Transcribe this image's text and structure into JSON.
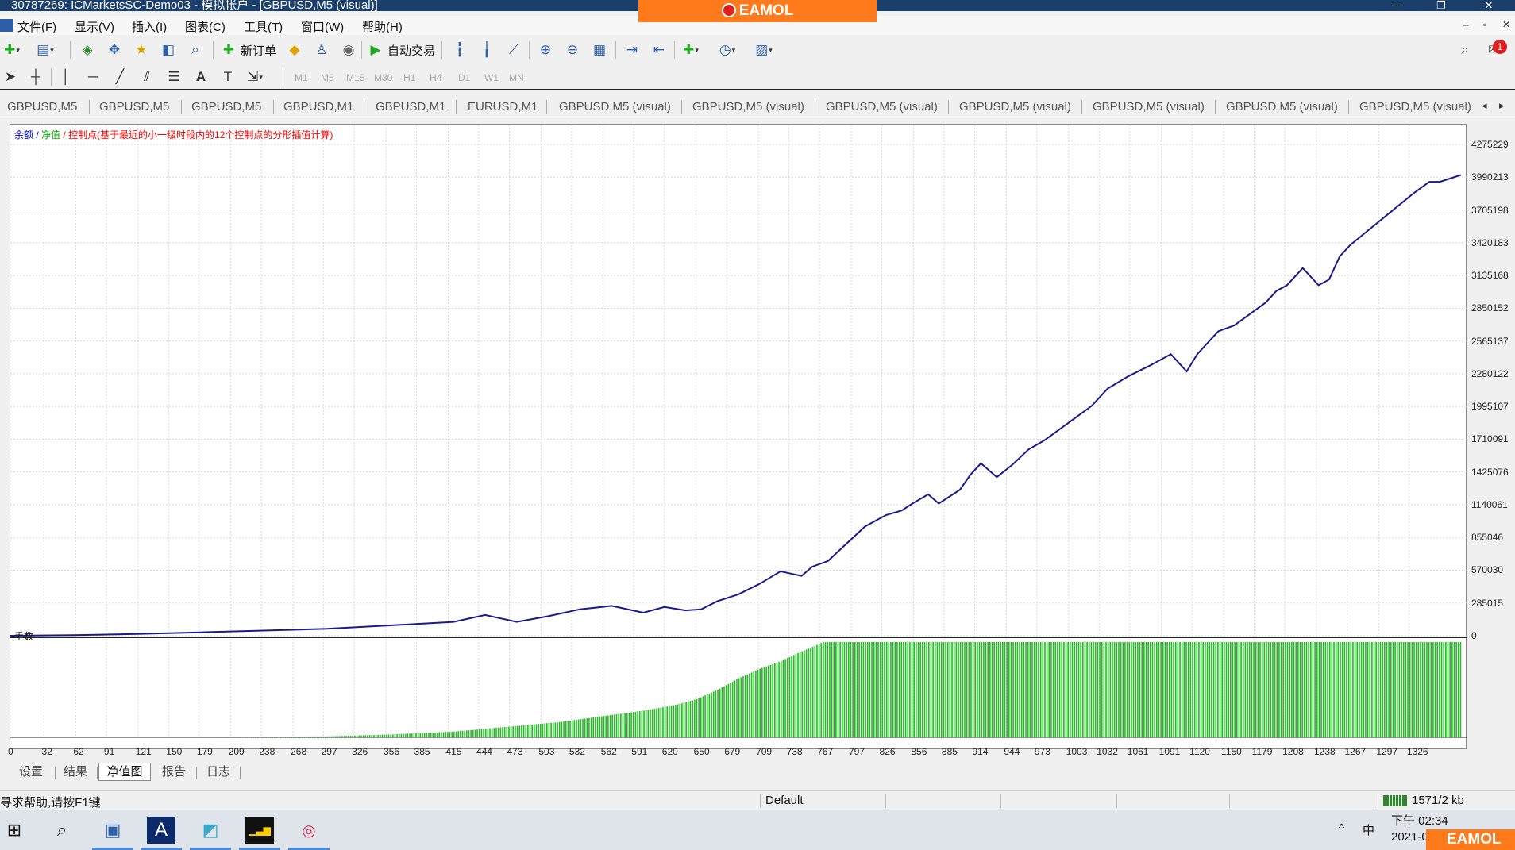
{
  "titlebar": {
    "title": "30787269: ICMarketsSC-Demo03 - 模拟帐户 - [GBPUSD,M5 (visual)]",
    "minimize": "–",
    "restore": "❐",
    "close": "✕"
  },
  "brand": {
    "text": "EAMOL"
  },
  "menu": {
    "items": [
      "文件(F)",
      "显示(V)",
      "插入(I)",
      "图表(C)",
      "工具(T)",
      "窗口(W)",
      "帮助(H)"
    ],
    "doc_controls": [
      "–",
      "▫",
      "✕"
    ]
  },
  "toolbar": {
    "new_order": "新订单",
    "auto_trading": "自动交易",
    "notification_count": "1"
  },
  "timeframes": [
    "M1",
    "M5",
    "M15",
    "M30",
    "H1",
    "H4",
    "D1",
    "W1",
    "MN"
  ],
  "chart_tabs": [
    "GBPUSD,M5",
    "GBPUSD,M5",
    "GBPUSD,M5",
    "GBPUSD,M1",
    "GBPUSD,M1",
    "EURUSD,M1",
    "GBPUSD,M5 (visual)",
    "GBPUSD,M5 (visual)",
    "GBPUSD,M5 (visual)",
    "GBPUSD,M5 (visual)",
    "GBPUSD,M5 (visual)",
    "GBPUSD,M5 (visual)",
    "GBPUSD,M5 (visual)"
  ],
  "legend": {
    "balance": "余额",
    "sep1": " / ",
    "equity": "净值",
    "sep2": " / ",
    "note": "控制点(基于最近的小一级时段内的12个控制点的分形插值计算)",
    "balance_color": "#0000cc",
    "equity_color": "#00a000",
    "note_color": "#ff0000"
  },
  "lot_label": "手数",
  "bottom_tabs": [
    "设置",
    "结果",
    "净值图",
    "报告",
    "日志"
  ],
  "status": {
    "help": "寻求帮助,请按F1键",
    "profile": "Default",
    "traffic": "1571/2 kb"
  },
  "tray": {
    "caret": "^",
    "ime": "中",
    "time": "下午 02:34",
    "date": "2021-0"
  },
  "chart_data": {
    "type": "line",
    "y_ticks": [
      "4275229",
      "3990213",
      "3705198",
      "3420183",
      "3135168",
      "2850152",
      "2565137",
      "2280122",
      "1995107",
      "1710091",
      "1425076",
      "1140061",
      "855046",
      "570030",
      "285015",
      "0"
    ],
    "x_ticks": [
      "0",
      "32",
      "62",
      "91",
      "121",
      "150",
      "179",
      "209",
      "238",
      "268",
      "297",
      "326",
      "356",
      "385",
      "415",
      "444",
      "473",
      "503",
      "532",
      "562",
      "591",
      "620",
      "650",
      "679",
      "709",
      "738",
      "767",
      "797",
      "826",
      "856",
      "885",
      "914",
      "944",
      "973",
      "1003",
      "1032",
      "1061",
      "1091",
      "1120",
      "1150",
      "1179",
      "1208",
      "1238",
      "1267",
      "1297",
      "1326"
    ],
    "ylim": [
      0,
      4275229
    ],
    "xlim": [
      0,
      1375
    ],
    "grid": true,
    "series": [
      {
        "name": "余额",
        "color": "#1a1a8c",
        "x": [
          0,
          60,
          120,
          180,
          240,
          300,
          360,
          420,
          450,
          480,
          510,
          540,
          570,
          600,
          620,
          640,
          655,
          670,
          690,
          710,
          730,
          750,
          760,
          775,
          790,
          810,
          830,
          845,
          855,
          870,
          880,
          900,
          910,
          920,
          935,
          950,
          965,
          980,
          995,
          1010,
          1025,
          1040,
          1060,
          1080,
          1100,
          1115,
          1125,
          1145,
          1160,
          1175,
          1190,
          1200,
          1210,
          1225,
          1240,
          1250,
          1260,
          1270,
          1290,
          1310,
          1330,
          1345,
          1355,
          1375
        ],
        "y": [
          0,
          5000,
          15000,
          30000,
          45000,
          60000,
          90000,
          120000,
          180000,
          120000,
          170000,
          230000,
          260000,
          200000,
          250000,
          220000,
          230000,
          300000,
          360000,
          450000,
          560000,
          520000,
          600000,
          650000,
          780000,
          950000,
          1050000,
          1090000,
          1150000,
          1230000,
          1150000,
          1270000,
          1400000,
          1500000,
          1380000,
          1490000,
          1620000,
          1700000,
          1800000,
          1900000,
          2000000,
          2150000,
          2260000,
          2350000,
          2450000,
          2300000,
          2450000,
          2650000,
          2700000,
          2800000,
          2900000,
          3000000,
          3050000,
          3200000,
          3050000,
          3100000,
          3300000,
          3400000,
          3550000,
          3700000,
          3850000,
          3950000,
          3950000,
          4010000
        ]
      }
    ],
    "lot_series": {
      "name": "手数",
      "color": "#22bb22",
      "ylim": [
        0,
        100
      ],
      "x": [
        0,
        100,
        200,
        300,
        360,
        420,
        450,
        480,
        520,
        560,
        600,
        630,
        650,
        670,
        690,
        710,
        730,
        745,
        760,
        770,
        1375
      ],
      "y": [
        0,
        0,
        0.5,
        1,
        3,
        6,
        9,
        12,
        16,
        22,
        28,
        34,
        40,
        50,
        62,
        72,
        80,
        88,
        95,
        100,
        100
      ]
    }
  }
}
